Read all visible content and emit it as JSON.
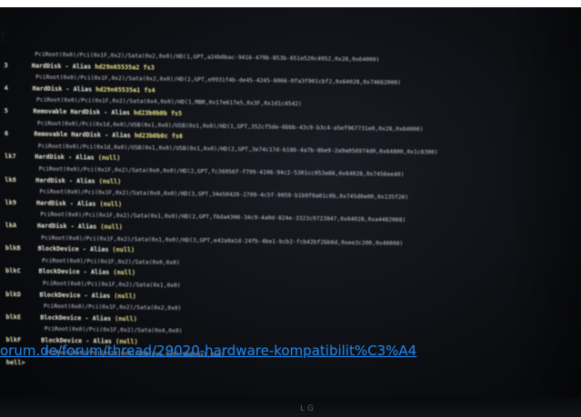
{
  "overlay": {
    "cut_text": "t",
    "link_text": "orum.de/forum/thread/29020-hardware-kompatibilit%C3%A4"
  },
  "monitor": {
    "brand": "LG"
  },
  "entries": [
    {
      "num": "",
      "path": "PciRoot(0x0)/Pci(0x1F,0x2)/Sata(0x2,0x0)/HD(1,GPT,a24b0bac-9416-479b-853b-651e520c4952,0x28,0x64000)",
      "name": ""
    },
    {
      "num": "3",
      "path": "",
      "name": "HardDisk - Alias hd29n65535a2 fs3"
    },
    {
      "num": "",
      "path": "PciRoot(0x0)/Pci(0x1F,0x2)/Sata(0x2,0x0)/HD(2,GPT,e9931f4b-de45-4245-8066-0fa3f901cbf2,0x64028,0x74662000)",
      "name": ""
    },
    {
      "num": "4",
      "path": "",
      "name": "HardDisk - Alias hd29n65535a1 fs4"
    },
    {
      "num": "",
      "path": "PciRoot(0x0)/Pci(0x1F,0x2)/Sata(0x4,0x0)/HD(1,MBR,0x17e617e5,0x3F,0x1d1c4542)",
      "name": ""
    },
    {
      "num": "5",
      "path": "",
      "name": "Removable HardDisk - Alias hd23b0b0b fs5"
    },
    {
      "num": "",
      "path": "PciRoot(0x0)/Pci(0x1d,0x0)/USB(0x1,0x0)/USB(0x1,0x0)/HD(1,GPT,352cf5de-6bbb-43c9-b3c4-a5ef967731e0,0x28,0x64000)",
      "name": ""
    },
    {
      "num": "6",
      "path": "",
      "name": "Removable HardDisk - Alias hd23b0b0c fs6"
    },
    {
      "num": "",
      "path": "PciRoot(0x0)/Pci(0x1d,0x0)/USB(0x1,0x0)/USB(0x1,0x0)/HD(2,GPT,3e74c17d-b186-4a7b-8be9-2a9a056974d0,0x64800,0x1c8300)",
      "name": ""
    },
    {
      "num": "lk7",
      "path": "",
      "name": "HardDisk - Alias (null)"
    },
    {
      "num": "",
      "path": "PciRoot(0x0)/Pci(0x1F,0x2)/Sata(0x0,0x0)/HD(2,GPT,fc36956f-f799-4106-94c2-5301cc053e66,0x64028,0x7456ee40)",
      "name": ""
    },
    {
      "num": "lk8",
      "path": "",
      "name": "HardDisk - Alias (null)"
    },
    {
      "num": "",
      "path": "PciRoot(0x0)/Pci(0x1F,0x2)/Sata(0x0,0x0)/HD(3,GPT,34e50420-2709-4c5f-9059-b1b9f0a01c0b,0x745d0e00,0x135f20)",
      "name": ""
    },
    {
      "num": "lk9",
      "path": "",
      "name": "HardDisk - Alias (null)"
    },
    {
      "num": "",
      "path": "PciRoot(0x0)/Pci(0x1F,0x2)/Sata(0x1,0x0)/HD(2,GPT,f6da4306-34c9-4a0d-824e-3323c9723847,0x64028,0xa4482068)",
      "name": ""
    },
    {
      "num": "lkA",
      "path": "",
      "name": "HardDisk - Alias (null)"
    },
    {
      "num": "",
      "path": "PciRoot(0x0)/Pci(0x1F,0x2)/Sata(0x1,0x0)/HD(3,GPT,e42a8a1d-24fb-4be1-bcb2-fcb42bf2bb6d,0xee3c200,0x40000)",
      "name": ""
    },
    {
      "num": "blkB",
      "path": "",
      "name": "BlockDevice - Alias (null)"
    },
    {
      "num": "",
      "path": "PciRoot(0x0)/Pci(0x1F,0x2)/Sata(0x0,0x0)",
      "name": ""
    },
    {
      "num": "blkC",
      "path": "",
      "name": "BlockDevice - Alias (null)"
    },
    {
      "num": "",
      "path": "PciRoot(0x0)/Pci(0x1F,0x2)/Sata(0x1,0x0)",
      "name": ""
    },
    {
      "num": "blkD",
      "path": "",
      "name": "BlockDevice - Alias (null)"
    },
    {
      "num": "",
      "path": "PciRoot(0x0)/Pci(0x1F,0x2)/Sata(0x2,0x0)",
      "name": ""
    },
    {
      "num": "blkE",
      "path": "",
      "name": "BlockDevice - Alias (null)"
    },
    {
      "num": "",
      "path": "PciRoot(0x0)/Pci(0x1F,0x2)/Sata(0x4,0x0)",
      "name": ""
    },
    {
      "num": "blkF",
      "path": "",
      "name": "BlockDevice - Alias (null)"
    },
    {
      "num": "",
      "path": "PciRoot(0x0)/Pci(0x1d,0x0)/USB(0x1,0x0)/USB(0x1,0x0)",
      "name": ""
    },
    {
      "num": "hell>",
      "path": "",
      "name": ""
    }
  ]
}
